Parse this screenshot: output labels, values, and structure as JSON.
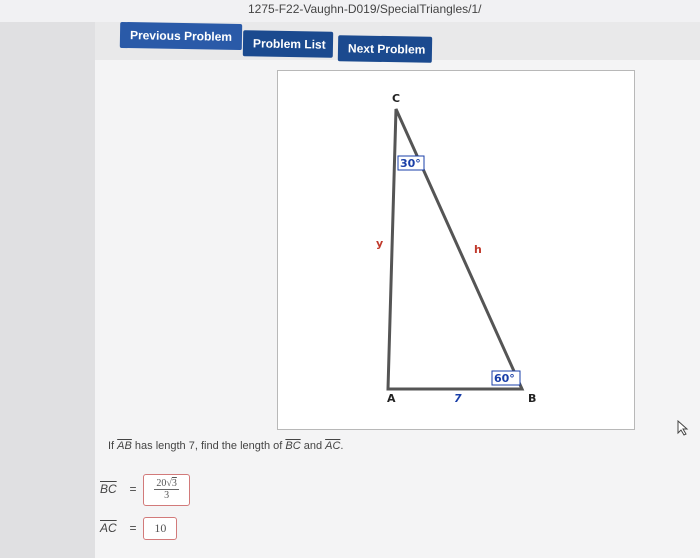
{
  "browser": {
    "url_fragment": "1275-F22-Vaughn-D019/SpecialTriangles/1/"
  },
  "nav": {
    "previous_label": "Previous Problem",
    "list_label": "Problem List",
    "next_label": "Next Problem"
  },
  "figure": {
    "vertex_c": "C",
    "vertex_a": "A",
    "vertex_b": "B",
    "angle_c": "30°",
    "angle_b": "60°",
    "side_ac": "y",
    "side_ab": "7",
    "side_bc": "h"
  },
  "question": {
    "prefix": "If ",
    "seg_ab": "AB",
    "middle": " has length 7, find the length of ",
    "seg_bc": "BC",
    "and": " and ",
    "seg_ac": "AC",
    "suffix": "."
  },
  "answers": {
    "bc_label": "BC",
    "bc_num_coeff": "20",
    "bc_num_rad": "3",
    "bc_den": "3",
    "ac_label": "AC",
    "ac_value": "10",
    "equals": "="
  },
  "colors": {
    "button": "#1b4a8f",
    "figure_label": "#c0392b",
    "angle_label": "#1a3fa8",
    "answer_border": "#d27a7a"
  }
}
